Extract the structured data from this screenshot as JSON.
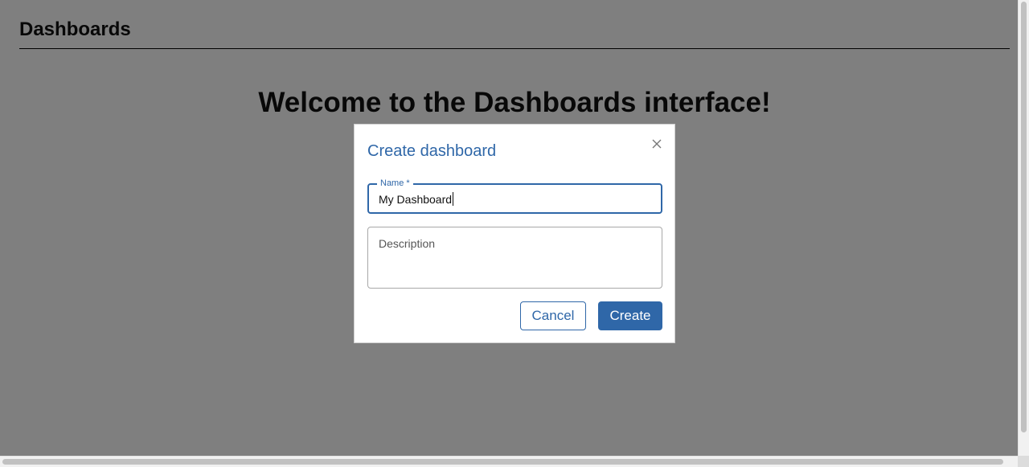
{
  "page": {
    "title": "Dashboards",
    "welcome": "Welcome to the Dashboards interface!"
  },
  "modal": {
    "title": "Create dashboard",
    "close_icon": "close-icon",
    "name_field": {
      "label": "Name *",
      "value": "My Dashboard"
    },
    "description_field": {
      "placeholder": "Description",
      "value": ""
    },
    "buttons": {
      "cancel": "Cancel",
      "create": "Create"
    }
  },
  "colors": {
    "accent": "#2f67a8",
    "overlay": "rgba(0,0,0,0.5)"
  }
}
